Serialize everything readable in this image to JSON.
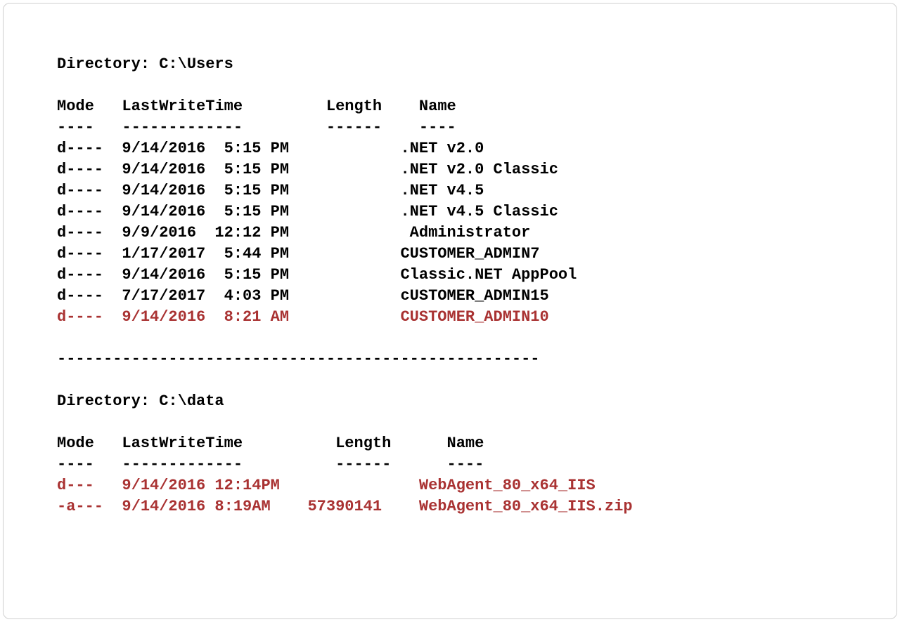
{
  "dir1": {
    "title": "Directory: C:\\Users",
    "headers": {
      "mode": "Mode",
      "time": "LastWriteTime",
      "length": "Length",
      "name": "Name"
    },
    "underlines": {
      "mode": "----",
      "time": "-------------",
      "length": "------",
      "name": "----"
    },
    "rows": [
      {
        "mode": "d----",
        "date": "9/14/2016",
        "time": "5:15 PM",
        "length": "",
        "name": ".NET v2.0",
        "hl": false
      },
      {
        "mode": "d----",
        "date": "9/14/2016",
        "time": "5:15 PM",
        "length": "",
        "name": ".NET v2.0 Classic",
        "hl": false
      },
      {
        "mode": "d----",
        "date": "9/14/2016",
        "time": "5:15 PM",
        "length": "",
        "name": ".NET v4.5",
        "hl": false
      },
      {
        "mode": "d----",
        "date": "9/14/2016",
        "time": "5:15 PM",
        "length": "",
        "name": ".NET v4.5 Classic",
        "hl": false
      },
      {
        "mode": "d----",
        "date": "9/9/2016",
        "time": "12:12 PM",
        "length": "",
        "name": " Administrator",
        "hl": false
      },
      {
        "mode": "d----",
        "date": "1/17/2017",
        "time": "5:44 PM",
        "length": "",
        "name": "CUSTOMER_ADMIN7",
        "hl": false
      },
      {
        "mode": "d----",
        "date": "9/14/2016",
        "time": "5:15 PM",
        "length": "",
        "name": "Classic.NET AppPool",
        "hl": false
      },
      {
        "mode": "d----",
        "date": "7/17/2017",
        "time": "4:03 PM",
        "length": "",
        "name": "cUSTOMER_ADMIN15",
        "hl": false
      },
      {
        "mode": "d----",
        "date": "9/14/2016",
        "time": "8:21 AM",
        "length": "",
        "name": "CUSTOMER_ADMIN10",
        "hl": true
      }
    ]
  },
  "separator": "----------------------------------------------------",
  "dir2": {
    "title": "Directory: C:\\data",
    "headers": {
      "mode": "Mode",
      "time": "LastWriteTime",
      "length": "Length",
      "name": "Name"
    },
    "underlines": {
      "mode": "----",
      "time": "-------------",
      "length": "------",
      "name": "----"
    },
    "rows": [
      {
        "mode": "d---",
        "date": "9/14/2016",
        "time": "12:14PM",
        "length": "",
        "name": "WebAgent_80_x64_IIS",
        "hl": true
      },
      {
        "mode": "-a---",
        "date": "9/14/2016",
        "time": "8:19AM",
        "length": "57390141",
        "name": "WebAgent_80_x64_IIS.zip",
        "hl": true
      }
    ]
  }
}
